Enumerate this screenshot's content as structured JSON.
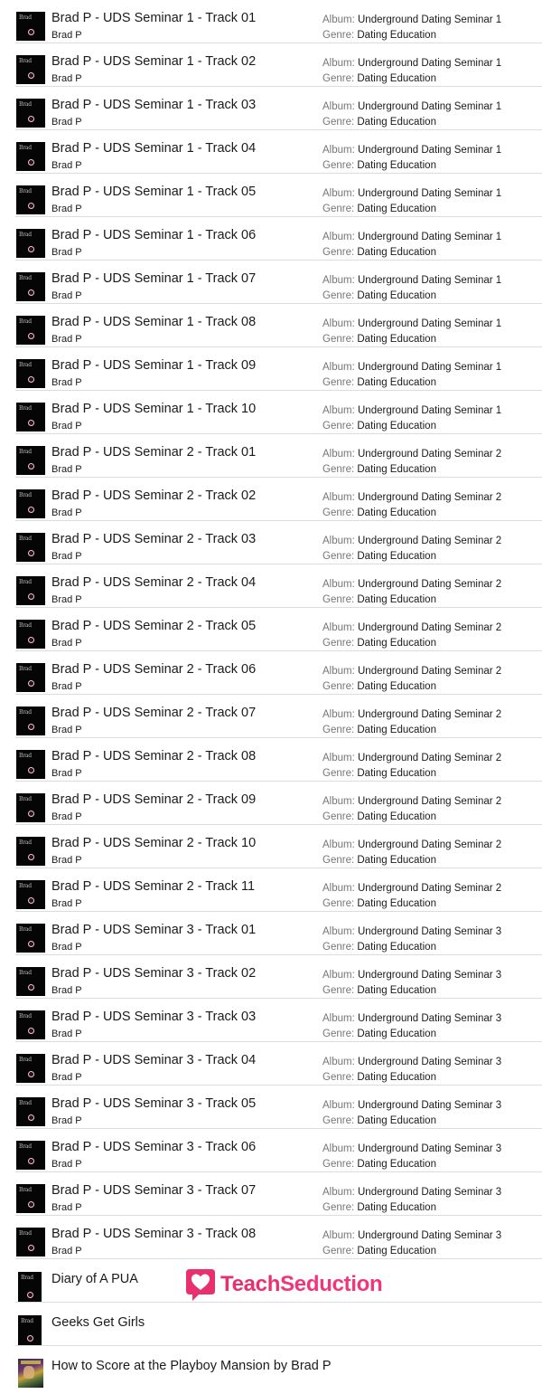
{
  "labels": {
    "album": "Album:",
    "genre": "Genre:"
  },
  "tracks": [
    {
      "title": "Brad P - UDS Seminar 1 - Track 01",
      "artist": "Brad P",
      "album": "Underground Dating Seminar 1",
      "genre": "Dating Education"
    },
    {
      "title": "Brad P - UDS Seminar 1 - Track 02",
      "artist": "Brad P",
      "album": "Underground Dating Seminar 1",
      "genre": "Dating Education"
    },
    {
      "title": "Brad P - UDS Seminar 1 - Track 03",
      "artist": "Brad P",
      "album": "Underground Dating Seminar 1",
      "genre": "Dating Education"
    },
    {
      "title": "Brad P - UDS Seminar 1 - Track 04",
      "artist": "Brad P",
      "album": "Underground Dating Seminar 1",
      "genre": "Dating Education"
    },
    {
      "title": "Brad P - UDS Seminar 1 - Track 05",
      "artist": "Brad P",
      "album": "Underground Dating Seminar 1",
      "genre": "Dating Education"
    },
    {
      "title": "Brad P - UDS Seminar 1 - Track 06",
      "artist": "Brad P",
      "album": "Underground Dating Seminar 1",
      "genre": "Dating Education"
    },
    {
      "title": "Brad P - UDS Seminar 1 - Track 07",
      "artist": "Brad P",
      "album": "Underground Dating Seminar 1",
      "genre": "Dating Education"
    },
    {
      "title": "Brad P - UDS Seminar 1 - Track 08",
      "artist": "Brad P",
      "album": "Underground Dating Seminar 1",
      "genre": "Dating Education"
    },
    {
      "title": "Brad P - UDS Seminar 1 - Track 09",
      "artist": "Brad P",
      "album": "Underground Dating Seminar 1",
      "genre": "Dating Education"
    },
    {
      "title": "Brad P - UDS Seminar 1 - Track 10",
      "artist": "Brad P",
      "album": "Underground Dating Seminar 1",
      "genre": "Dating Education"
    },
    {
      "title": "Brad P - UDS Seminar 2 - Track 01",
      "artist": "Brad P",
      "album": "Underground Dating Seminar 2",
      "genre": "Dating Education"
    },
    {
      "title": "Brad P - UDS Seminar 2 - Track 02",
      "artist": "Brad P",
      "album": "Underground Dating Seminar 2",
      "genre": "Dating Education"
    },
    {
      "title": "Brad P - UDS Seminar 2 - Track 03",
      "artist": "Brad P",
      "album": "Underground Dating Seminar 2",
      "genre": "Dating Education"
    },
    {
      "title": "Brad P - UDS Seminar 2 - Track 04",
      "artist": "Brad P",
      "album": "Underground Dating Seminar 2",
      "genre": "Dating Education"
    },
    {
      "title": "Brad P - UDS Seminar 2 - Track 05",
      "artist": "Brad P",
      "album": "Underground Dating Seminar 2",
      "genre": "Dating Education"
    },
    {
      "title": "Brad P - UDS Seminar 2 - Track 06",
      "artist": "Brad P",
      "album": "Underground Dating Seminar 2",
      "genre": "Dating Education"
    },
    {
      "title": "Brad P - UDS Seminar 2 - Track 07",
      "artist": "Brad P",
      "album": "Underground Dating Seminar 2",
      "genre": "Dating Education"
    },
    {
      "title": "Brad P - UDS Seminar 2 - Track 08",
      "artist": "Brad P",
      "album": "Underground Dating Seminar 2",
      "genre": "Dating Education"
    },
    {
      "title": "Brad P - UDS Seminar 2 - Track 09",
      "artist": "Brad P",
      "album": "Underground Dating Seminar 2",
      "genre": "Dating Education"
    },
    {
      "title": "Brad P - UDS Seminar 2 - Track 10",
      "artist": "Brad P",
      "album": "Underground Dating Seminar 2",
      "genre": "Dating Education"
    },
    {
      "title": "Brad P - UDS Seminar 2 - Track 11",
      "artist": "Brad P",
      "album": "Underground Dating Seminar 2",
      "genre": "Dating Education"
    },
    {
      "title": "Brad P - UDS Seminar 3 - Track 01",
      "artist": "Brad P",
      "album": "Underground Dating Seminar 3",
      "genre": "Dating Education"
    },
    {
      "title": "Brad P - UDS Seminar 3 - Track 02",
      "artist": "Brad P",
      "album": "Underground Dating Seminar 3",
      "genre": "Dating Education"
    },
    {
      "title": "Brad P - UDS Seminar 3 - Track 03",
      "artist": "Brad P",
      "album": "Underground Dating Seminar 3",
      "genre": "Dating Education"
    },
    {
      "title": "Brad P - UDS Seminar 3 - Track 04",
      "artist": "Brad P",
      "album": "Underground Dating Seminar 3",
      "genre": "Dating Education"
    },
    {
      "title": "Brad P - UDS Seminar 3 - Track 05",
      "artist": "Brad P",
      "album": "Underground Dating Seminar 3",
      "genre": "Dating Education"
    },
    {
      "title": "Brad P - UDS Seminar 3 - Track 06",
      "artist": "Brad P",
      "album": "Underground Dating Seminar 3",
      "genre": "Dating Education"
    },
    {
      "title": "Brad P - UDS Seminar 3 - Track 07",
      "artist": "Brad P",
      "album": "Underground Dating Seminar 3",
      "genre": "Dating Education"
    },
    {
      "title": "Brad P - UDS Seminar 3 - Track 08",
      "artist": "Brad P",
      "album": "Underground Dating Seminar 3",
      "genre": "Dating Education"
    }
  ],
  "books": [
    {
      "title": "Diary of A PUA",
      "icon": "book-cover-icon"
    },
    {
      "title": "Geeks Get Girls",
      "icon": "book-cover-icon"
    },
    {
      "title": "How to Score at the Playboy Mansion by Brad P",
      "icon": "book-cover-art-icon"
    }
  ],
  "thumb_text": "Brad",
  "watermark": {
    "part1": "Teach",
    "part2": "Seduction",
    "color": "#e8306f"
  }
}
